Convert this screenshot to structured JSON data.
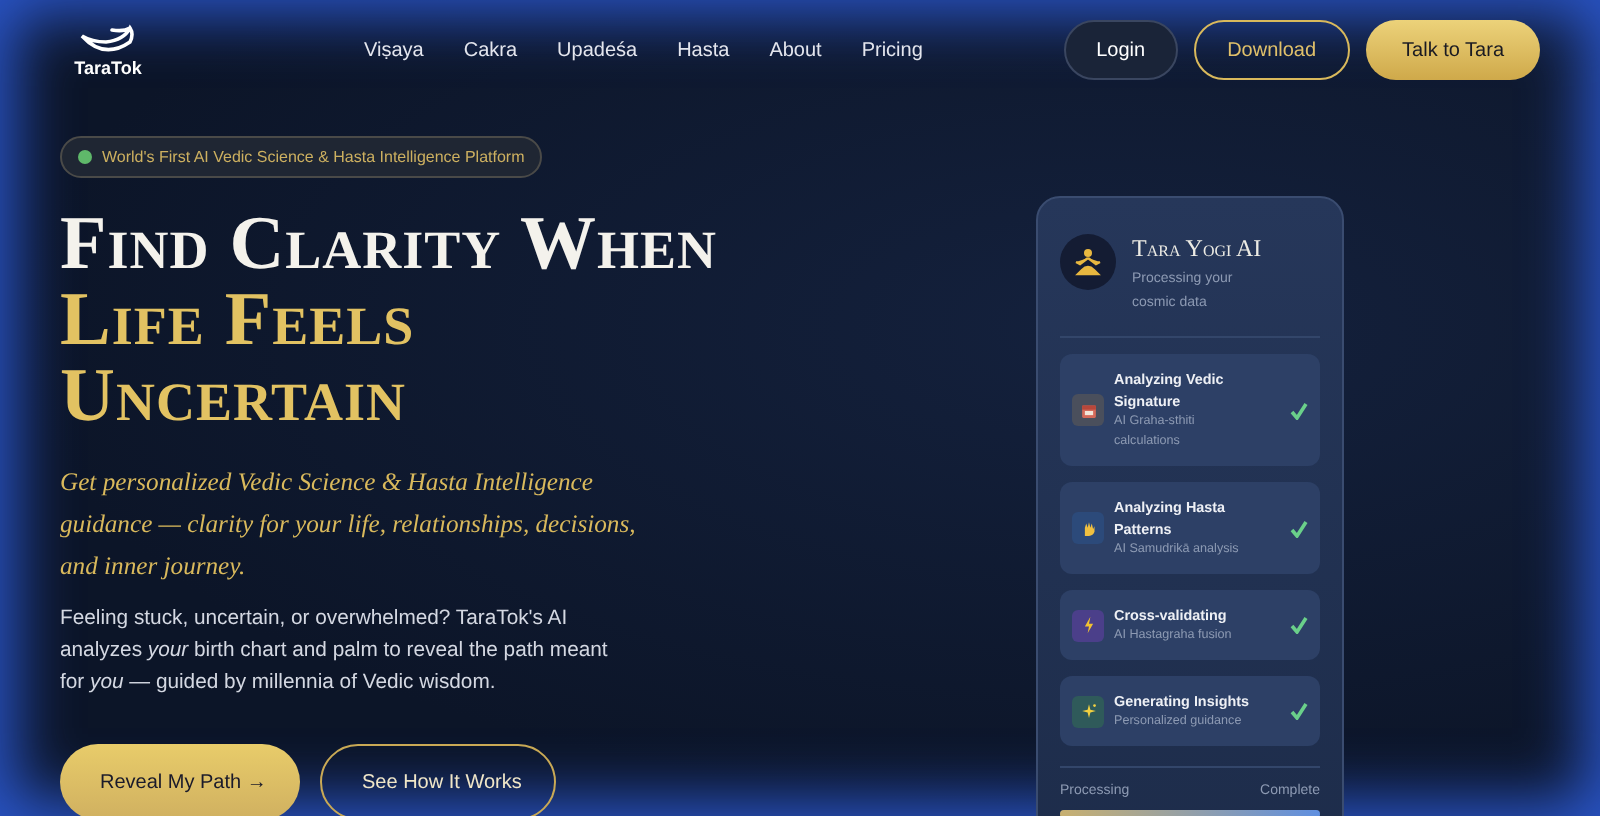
{
  "brand": {
    "name": "TaraTok"
  },
  "nav": {
    "links": [
      "Viṣaya",
      "Cakra",
      "Upadeśa",
      "Hasta",
      "About",
      "Pricing"
    ],
    "buttons": [
      {
        "label": "Login",
        "kind": "ghost"
      },
      {
        "label": "Download",
        "kind": "outline"
      },
      {
        "label": "Talk to Tara",
        "kind": "primary"
      }
    ]
  },
  "hero": {
    "badge": "World's First AI Vedic Science & Hasta Intelligence Platform",
    "heading": [
      {
        "text": "Find Clarity When",
        "kind": "white"
      },
      {
        "text": "Life Feels",
        "kind": "gold"
      },
      {
        "text": "Uncertain",
        "kind": "gold"
      }
    ],
    "subtitle": "Get personalized Vedic Science & Hasta Intelligence guidance — clarity for your life, relationships, decisions, and inner journey.",
    "body": "Feeling stuck, uncertain, or overwhelmed? TaraTok's AI analyzes *your* birth chart and palm to reveal the path meant for *you* — guided by millennia of Vedic wisdom.",
    "buttons": [
      {
        "label": "Reveal My Path →",
        "kind": "primary"
      },
      {
        "label": "See How It Works",
        "kind": "outline"
      }
    ]
  },
  "card": {
    "title": "Tara Yogi AI",
    "subtitle": "Processing your cosmic data",
    "steps": [
      {
        "title": "Analyzing Vedic Signature",
        "detail": "AI Graha-sthiti calculations",
        "kind": "calendar",
        "color": "#4a4f5c",
        "done": true
      },
      {
        "title": "Analyzing Hasta Patterns",
        "detail": "AI Samudrikā analysis",
        "kind": "hand",
        "color": "#2c4a7a",
        "done": true
      },
      {
        "title": "Cross-validating",
        "detail": "AI Hastagraha fusion",
        "kind": "bolt",
        "color": "#4b3f8a",
        "done": true
      },
      {
        "title": "Generating Insights",
        "detail": "Personalized guidance",
        "kind": "sparkle",
        "color": "#2f5a5a",
        "done": true
      }
    ],
    "progress": {
      "start": "Processing",
      "end": "Complete",
      "level": 1
    }
  }
}
